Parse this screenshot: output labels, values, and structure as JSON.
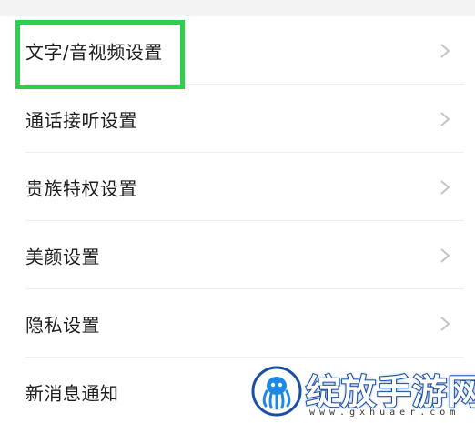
{
  "settings": {
    "items": [
      {
        "label": "文字/音视频设置",
        "icon": "chevron-right-icon",
        "color": "#1e1e1e"
      },
      {
        "label": "通话接听设置",
        "icon": "chevron-right-icon",
        "color": "#1e1e1e"
      },
      {
        "label": "贵族特权设置",
        "icon": "chevron-right-icon",
        "color": "#1e1e1e"
      },
      {
        "label": "美颜设置",
        "icon": "chevron-right-icon",
        "color": "#1e1e1e"
      },
      {
        "label": "隐私设置",
        "icon": "chevron-right-icon",
        "color": "#1e1e1e"
      },
      {
        "label": "新消息通知",
        "icon": "chevron-right-icon",
        "color": "#1e1e1e"
      }
    ]
  },
  "highlight": {
    "color": "#2ecf4e"
  },
  "watermark": {
    "text": "绽放手游网",
    "url": "www.gxhuaer.com",
    "logo_icon": "octopus-logo-icon",
    "color": "#1a4fa8"
  }
}
